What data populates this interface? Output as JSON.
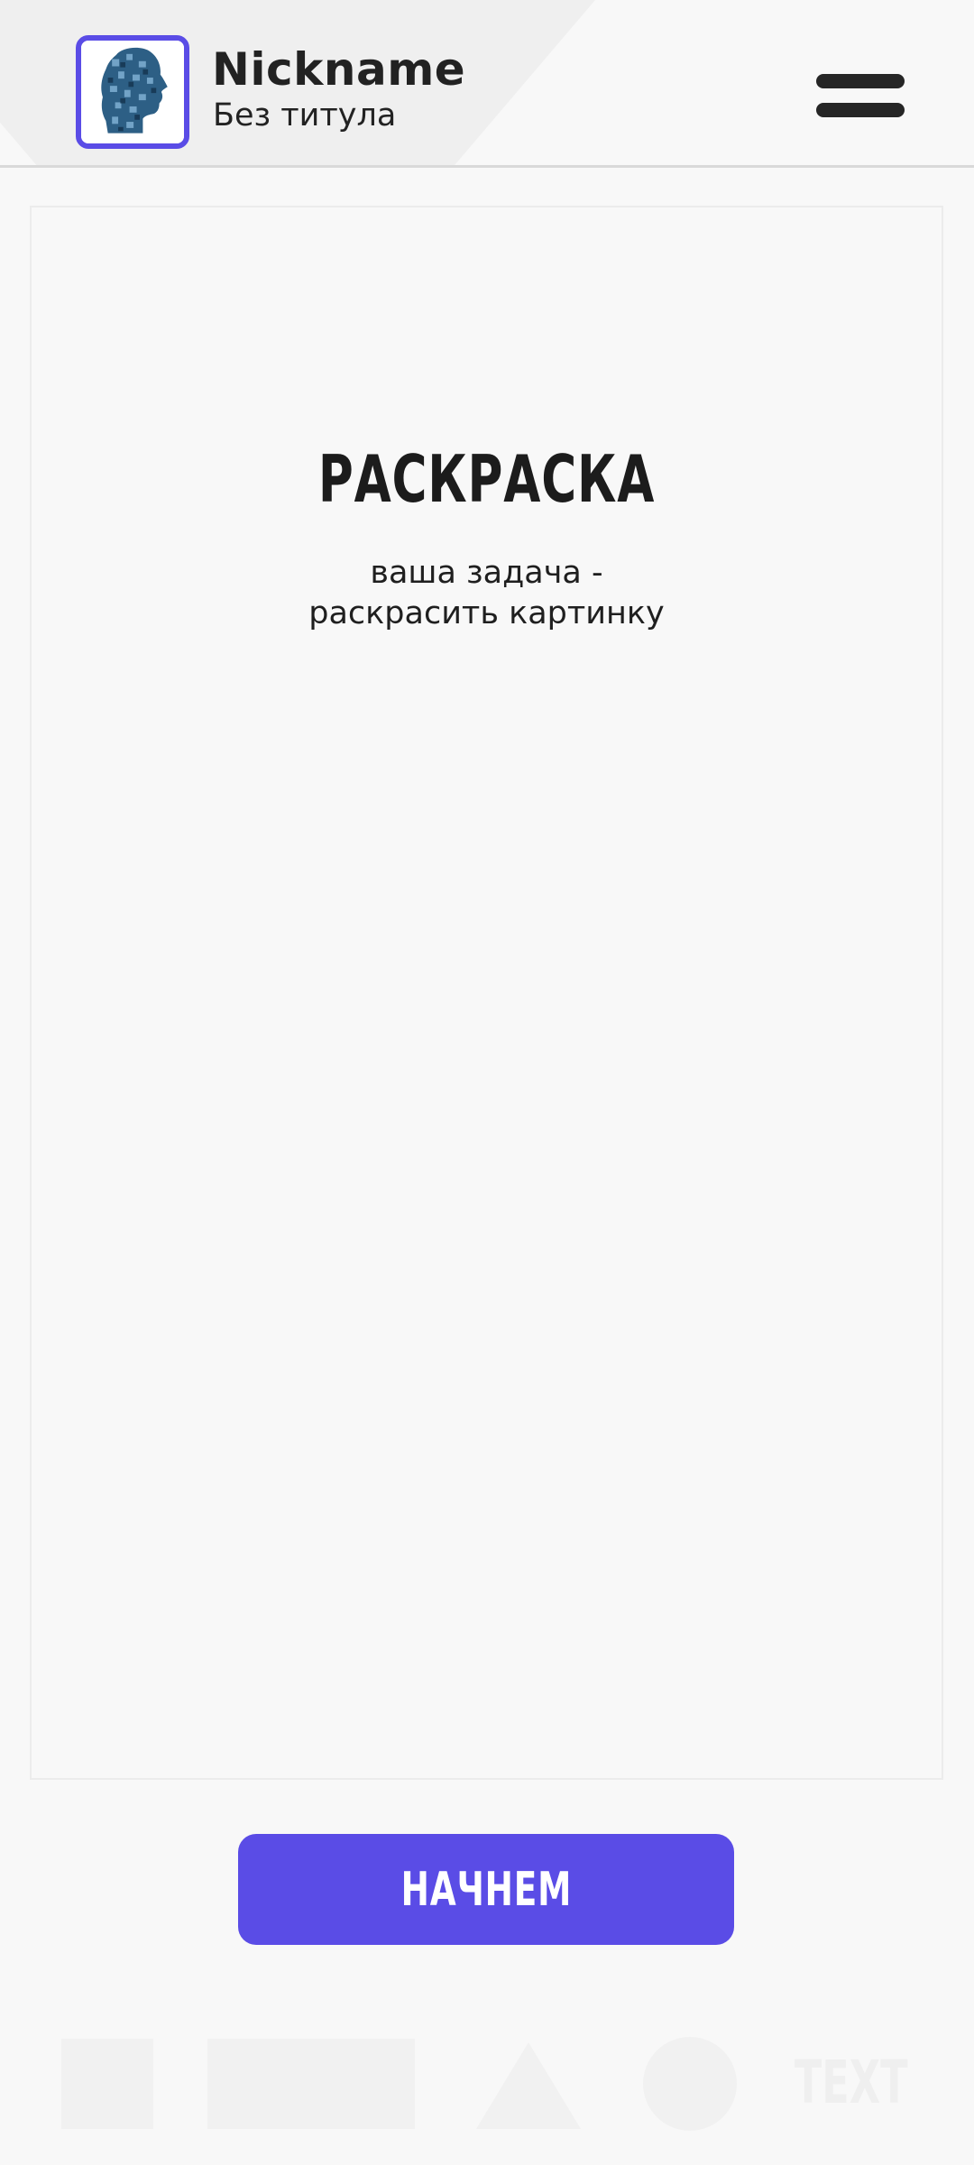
{
  "header": {
    "nickname": "Nickname",
    "subtitle": "Без титула",
    "avatar_icon": "puzzle-head-avatar",
    "menu_icon": "hamburger-menu-icon"
  },
  "card": {
    "title": "РАСКРАСКА",
    "description_line1": "ваша задача -",
    "description_line2": "раскрасить картинку"
  },
  "start_button": {
    "label": "НАЧНЕМ"
  },
  "tools": {
    "text_label": "TEXT",
    "items": [
      "square",
      "rectangle",
      "triangle",
      "circle",
      "text"
    ]
  },
  "colors": {
    "accent": "#5a4ce6",
    "background": "#f8f8f8",
    "text": "#1f1f1f"
  }
}
